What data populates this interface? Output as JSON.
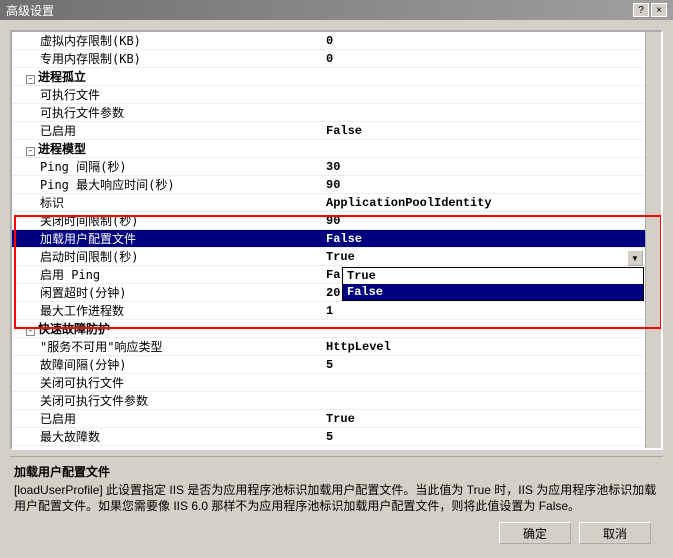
{
  "window": {
    "title": "高级设置",
    "help_icon": "?",
    "close_icon": "×"
  },
  "rows": [
    {
      "label": "虚拟内存限制(KB)",
      "value": "0"
    },
    {
      "label": "专用内存限制(KB)",
      "value": "0"
    },
    {
      "cat": true,
      "label": "进程孤立"
    },
    {
      "label": "可执行文件",
      "value": ""
    },
    {
      "label": "可执行文件参数",
      "value": ""
    },
    {
      "label": "已启用",
      "value": "False"
    },
    {
      "cat": true,
      "label": "进程模型"
    },
    {
      "label": "Ping 间隔(秒)",
      "value": "30"
    },
    {
      "label": "Ping 最大响应时间(秒)",
      "value": "90"
    },
    {
      "label": "标识",
      "value": "ApplicationPoolIdentity"
    },
    {
      "label": "关闭时间限制(秒)",
      "value": "90"
    },
    {
      "label": "加载用户配置文件",
      "value": "False",
      "selected": true
    },
    {
      "label": "启动时间限制(秒)",
      "value": "True"
    },
    {
      "label": "启用 Ping",
      "value": "False"
    },
    {
      "label": "闲置超时(分钟)",
      "value": "20"
    },
    {
      "label": "最大工作进程数",
      "value": "1"
    },
    {
      "cat": true,
      "label": "快速故障防护"
    },
    {
      "label": "\"服务不可用\"响应类型",
      "value": "HttpLevel"
    },
    {
      "label": "故障间隔(分钟)",
      "value": "5"
    },
    {
      "label": "关闭可执行文件",
      "value": ""
    },
    {
      "label": "关闭可执行文件参数",
      "value": ""
    },
    {
      "label": "已启用",
      "value": "True"
    },
    {
      "label": "最大故障数",
      "value": "5"
    }
  ],
  "dropdown": {
    "options": [
      "True",
      "False"
    ],
    "selected": "False"
  },
  "description": {
    "title": "加载用户配置文件",
    "text": "[loadUserProfile] 此设置指定 IIS 是否为应用程序池标识加载用户配置文件。当此值为 True 时，IIS 为应用程序池标识加载用户配置文件。如果您需要像 IIS 6.0 那样不为应用程序池标识加载用户配置文件，则将此值设置为 False。"
  },
  "buttons": {
    "ok": "确定",
    "cancel": "取消"
  },
  "toggle_glyph": "-"
}
